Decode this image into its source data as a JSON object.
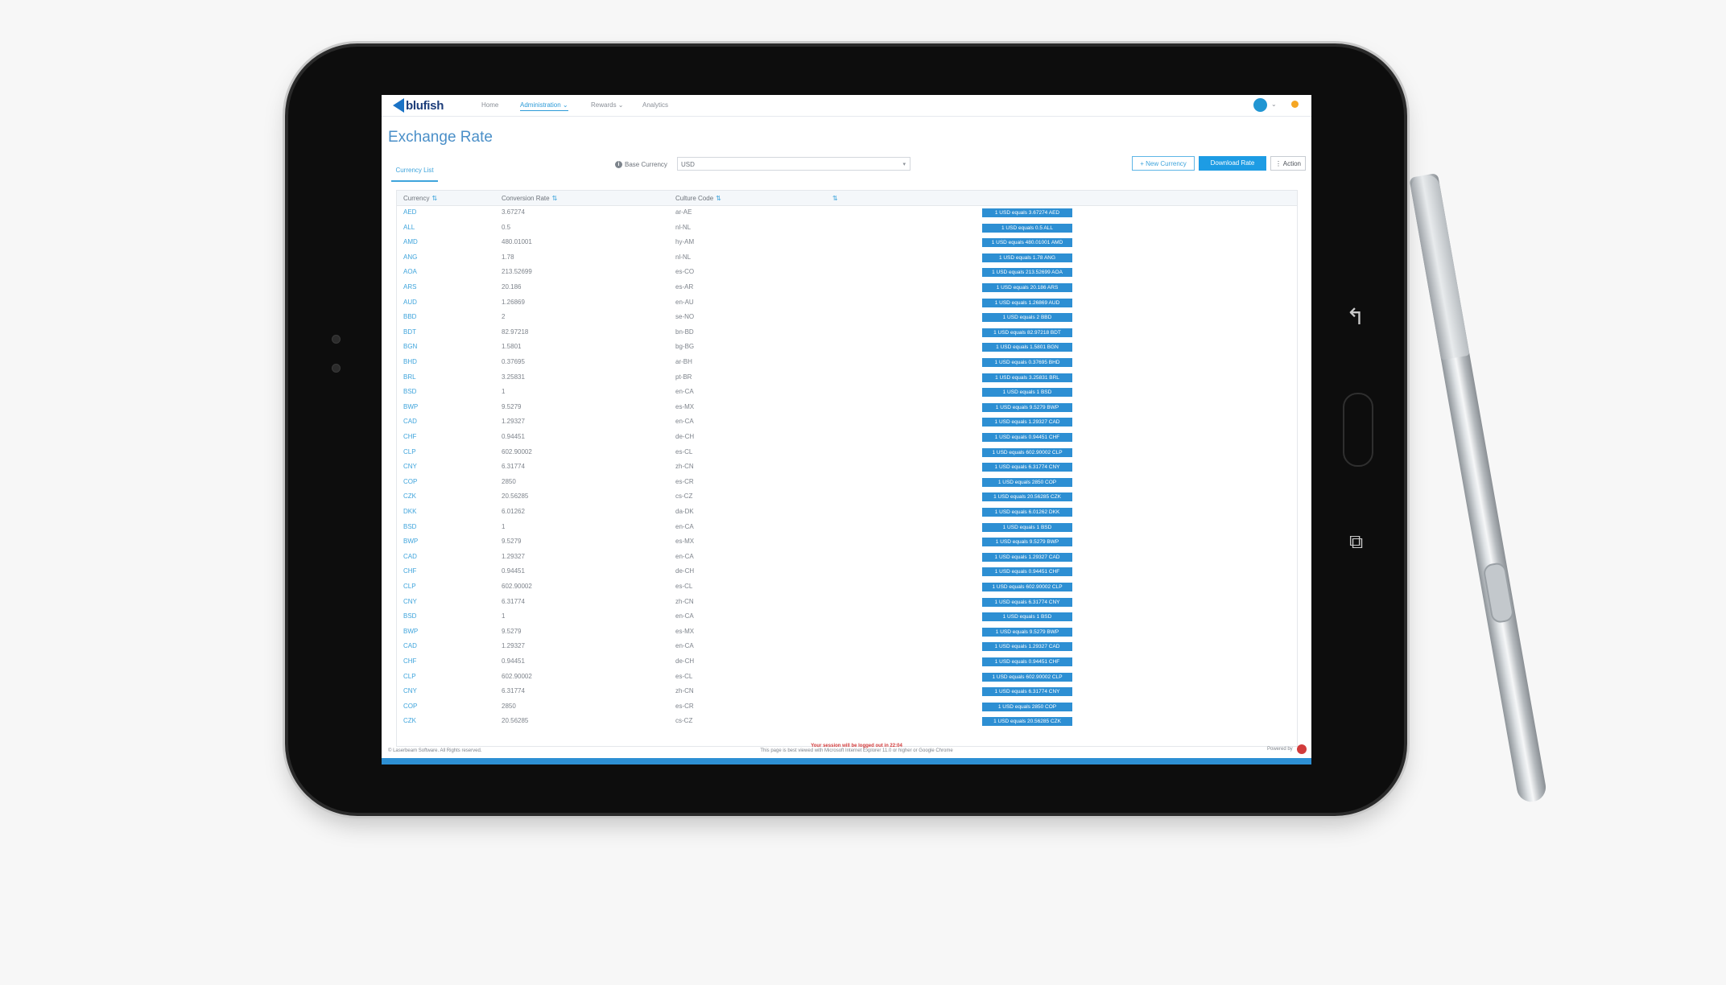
{
  "nav": {
    "brand": "blufish",
    "items": [
      "Home",
      "Administration ⌄",
      "Rewards ⌄",
      "Analytics"
    ]
  },
  "page": {
    "title": "Exchange Rate",
    "tab": "Currency List",
    "base_currency_label": "Base Currency",
    "base_currency_value": "USD"
  },
  "actions": {
    "new_currency": "+ New Currency",
    "download_rate": "Download Rate",
    "action": "⋮ Action"
  },
  "table": {
    "headers": [
      "Currency",
      "Conversion Rate",
      "Culture Code",
      ""
    ],
    "rows": [
      [
        "AED",
        "3.67274",
        "ar-AE",
        "1 USD equals 3.67274 AED"
      ],
      [
        "ALL",
        "0.5",
        "nl-NL",
        "1 USD equals 0.5 ALL"
      ],
      [
        "AMD",
        "480.01001",
        "hy-AM",
        "1 USD equals 480.01001 AMD"
      ],
      [
        "ANG",
        "1.78",
        "nl-NL",
        "1 USD equals 1.78 ANG"
      ],
      [
        "AOA",
        "213.52699",
        "es-CO",
        "1 USD equals 213.52699 AOA"
      ],
      [
        "ARS",
        "20.186",
        "es-AR",
        "1 USD equals 20.186 ARS"
      ],
      [
        "AUD",
        "1.26869",
        "en-AU",
        "1 USD equals 1.26869 AUD"
      ],
      [
        "BBD",
        "2",
        "se-NO",
        "1 USD equals 2 BBD"
      ],
      [
        "BDT",
        "82.97218",
        "bn-BD",
        "1 USD equals 82.97218 BDT"
      ],
      [
        "BGN",
        "1.5801",
        "bg-BG",
        "1 USD equals 1.5801 BGN"
      ],
      [
        "BHD",
        "0.37695",
        "ar-BH",
        "1 USD equals 0.37695 BHD"
      ],
      [
        "BRL",
        "3.25831",
        "pt-BR",
        "1 USD equals 3.25831 BRL"
      ],
      [
        "BSD",
        "1",
        "en-CA",
        "1 USD equals 1 BSD"
      ],
      [
        "BWP",
        "9.5279",
        "es-MX",
        "1 USD equals 9.5279 BWP"
      ],
      [
        "CAD",
        "1.29327",
        "en-CA",
        "1 USD equals 1.29327 CAD"
      ],
      [
        "CHF",
        "0.94451",
        "de-CH",
        "1 USD equals 0.94451 CHF"
      ],
      [
        "CLP",
        "602.90002",
        "es-CL",
        "1 USD equals 602.90002 CLP"
      ],
      [
        "CNY",
        "6.31774",
        "zh-CN",
        "1 USD equals 6.31774 CNY"
      ],
      [
        "COP",
        "2850",
        "es-CR",
        "1 USD equals 2850 COP"
      ],
      [
        "CZK",
        "20.56285",
        "cs-CZ",
        "1 USD equals 20.56285 CZK"
      ],
      [
        "DKK",
        "6.01262",
        "da-DK",
        "1 USD equals 6.01262 DKK"
      ],
      [
        "BSD",
        "1",
        "en-CA",
        "1 USD equals 1 BSD"
      ],
      [
        "BWP",
        "9.5279",
        "es-MX",
        "1 USD equals 9.5279 BWP"
      ],
      [
        "CAD",
        "1.29327",
        "en-CA",
        "1 USD equals 1.29327 CAD"
      ],
      [
        "CHF",
        "0.94451",
        "de-CH",
        "1 USD equals 0.94451 CHF"
      ],
      [
        "CLP",
        "602.90002",
        "es-CL",
        "1 USD equals 602.90002 CLP"
      ],
      [
        "CNY",
        "6.31774",
        "zh-CN",
        "1 USD equals 6.31774 CNY"
      ],
      [
        "BSD",
        "1",
        "en-CA",
        "1 USD equals 1 BSD"
      ],
      [
        "BWP",
        "9.5279",
        "es-MX",
        "1 USD equals 9.5279 BWP"
      ],
      [
        "CAD",
        "1.29327",
        "en-CA",
        "1 USD equals 1.29327 CAD"
      ],
      [
        "CHF",
        "0.94451",
        "de-CH",
        "1 USD equals 0.94451 CHF"
      ],
      [
        "CLP",
        "602.90002",
        "es-CL",
        "1 USD equals 602.90002 CLP"
      ],
      [
        "CNY",
        "6.31774",
        "zh-CN",
        "1 USD equals 6.31774 CNY"
      ],
      [
        "COP",
        "2850",
        "es-CR",
        "1 USD equals 2850 COP"
      ],
      [
        "CZK",
        "20.56285",
        "cs-CZ",
        "1 USD equals 20.56285 CZK"
      ]
    ]
  },
  "footer": {
    "copyright": "© Laserbeam Software. All Rights reserved.",
    "session_warning": "Your session will be logged out in 22:04",
    "browser_note": "This page is best viewed with Microsoft Internet Explorer 11.0 or higher or Google Chrome",
    "powered_by": "Powered by"
  },
  "colors": {
    "accent": "#1d9ce4",
    "badge": "#2d8fd3",
    "warning": "#d23b3b"
  },
  "icons": [
    "search-icon",
    "info-icon",
    "chevron-down-icon",
    "user-avatar-icon",
    "notification-icon",
    "back-icon",
    "recent-apps-icon"
  ]
}
